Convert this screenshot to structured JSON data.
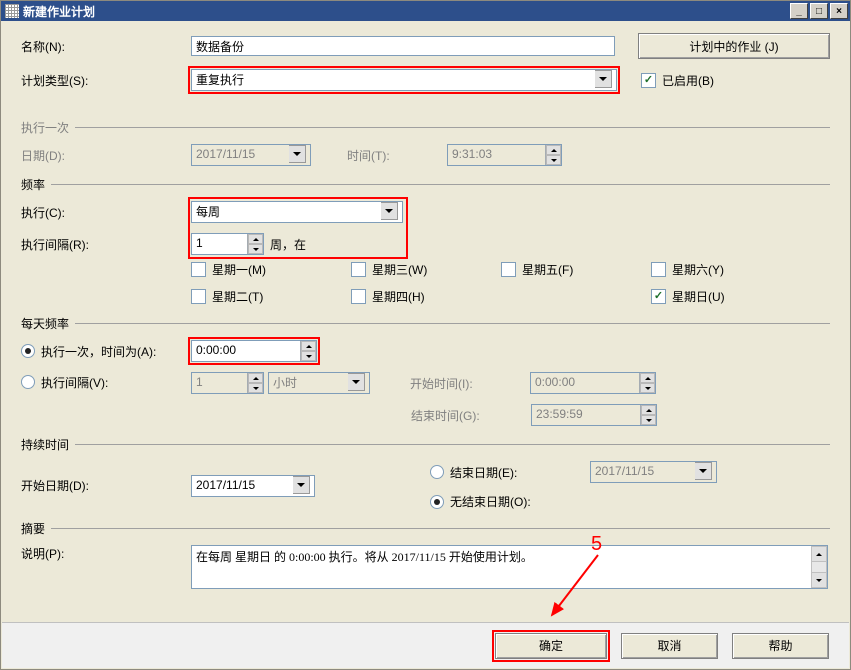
{
  "window": {
    "title": "新建作业计划"
  },
  "buttons": {
    "jobs_in_schedule": "计划中的作业 (J)",
    "ok": "确定",
    "cancel": "取消",
    "help": "帮助"
  },
  "fields": {
    "name_label": "名称(N):",
    "name_value": "数据备份",
    "schedule_type_label": "计划类型(S):",
    "schedule_type_value": "重复执行",
    "enabled_label": "已启用(B)"
  },
  "sections": {
    "once": "执行一次",
    "frequency": "频率",
    "daily_frequency": "每天频率",
    "duration": "持续时间",
    "summary": "摘要"
  },
  "once": {
    "date_label": "日期(D):",
    "date_value": "2017/11/15",
    "time_label": "时间(T):",
    "time_value": "9:31:03"
  },
  "frequency": {
    "occurs_label": "执行(C):",
    "occurs_value": "每周",
    "recurs_label": "执行间隔(R):",
    "recurs_value": "1",
    "recurs_unit": "周，在",
    "days": {
      "mon": "星期一(M)",
      "tue": "星期二(T)",
      "wed": "星期三(W)",
      "thu": "星期四(H)",
      "fri": "星期五(F)",
      "sat": "星期六(Y)",
      "sun": "星期日(U)"
    }
  },
  "daily_freq": {
    "once_label": "执行一次，时间为(A):",
    "once_value": "0:00:00",
    "every_label": "执行间隔(V):",
    "every_value": "1",
    "every_unit": "小时",
    "start_label": "开始时间(I):",
    "start_value": "0:00:00",
    "end_label": "结束时间(G):",
    "end_value": "23:59:59"
  },
  "duration": {
    "start_date_label": "开始日期(D):",
    "start_date_value": "2017/11/15",
    "end_date_label": "结束日期(E):",
    "end_date_value": "2017/11/15",
    "no_end_date_label": "无结束日期(O):"
  },
  "summary": {
    "description_label": "说明(P):",
    "description_value": "在每周 星期日 的 0:00:00 执行。将从 2017/11/15 开始使用计划。"
  },
  "annotations": {
    "five": "5"
  }
}
